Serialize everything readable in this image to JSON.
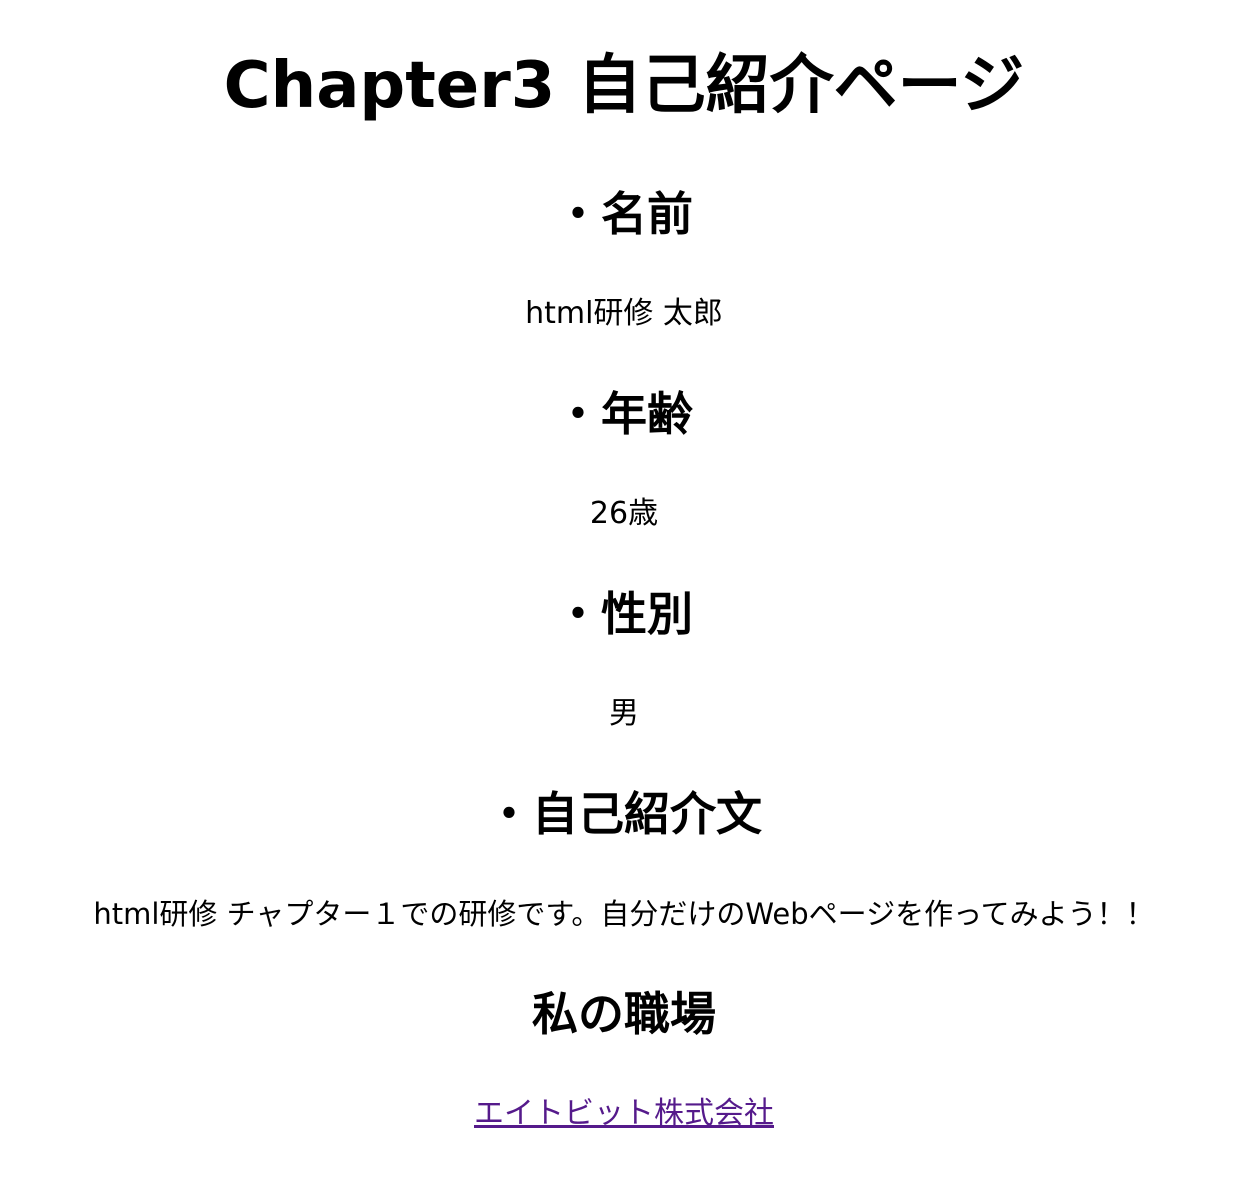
{
  "page": {
    "title": "Chapter3 自己紹介ページ"
  },
  "sections": {
    "name": {
      "heading": "・名前",
      "value": "html研修 太郎"
    },
    "age": {
      "heading": "・年齢",
      "value": "26歳"
    },
    "gender": {
      "heading": "・性別",
      "value": "男"
    },
    "intro": {
      "heading": "・自己紹介文",
      "value": "html研修 チャプター１での研修です。自分だけのWebページを作ってみよう！！"
    },
    "workplace": {
      "heading": "私の職場",
      "link_text": "エイトビット株式会社"
    }
  },
  "colors": {
    "text": "#000000",
    "visited_link": "#551a8b",
    "background": "#ffffff"
  }
}
